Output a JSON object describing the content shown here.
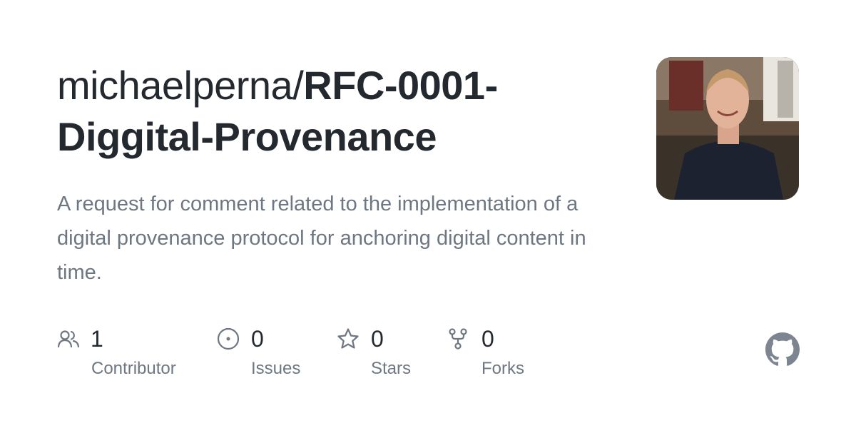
{
  "repo": {
    "owner": "michaelperna/",
    "name": "RFC-0001-Diggital-Provenance",
    "description": "A request for comment related to the implementation of a digital provenance protocol for anchoring digital content in time."
  },
  "stats": [
    {
      "icon": "people-icon",
      "value": "1",
      "label": "Contributor"
    },
    {
      "icon": "issue-icon",
      "value": "0",
      "label": "Issues"
    },
    {
      "icon": "star-icon",
      "value": "0",
      "label": "Stars"
    },
    {
      "icon": "fork-icon",
      "value": "0",
      "label": "Forks"
    }
  ],
  "colors": {
    "title": "#24292f",
    "muted": "#6e7781",
    "github_logo": "#7d8590"
  },
  "footer": {
    "logo": "github-mark-icon"
  }
}
